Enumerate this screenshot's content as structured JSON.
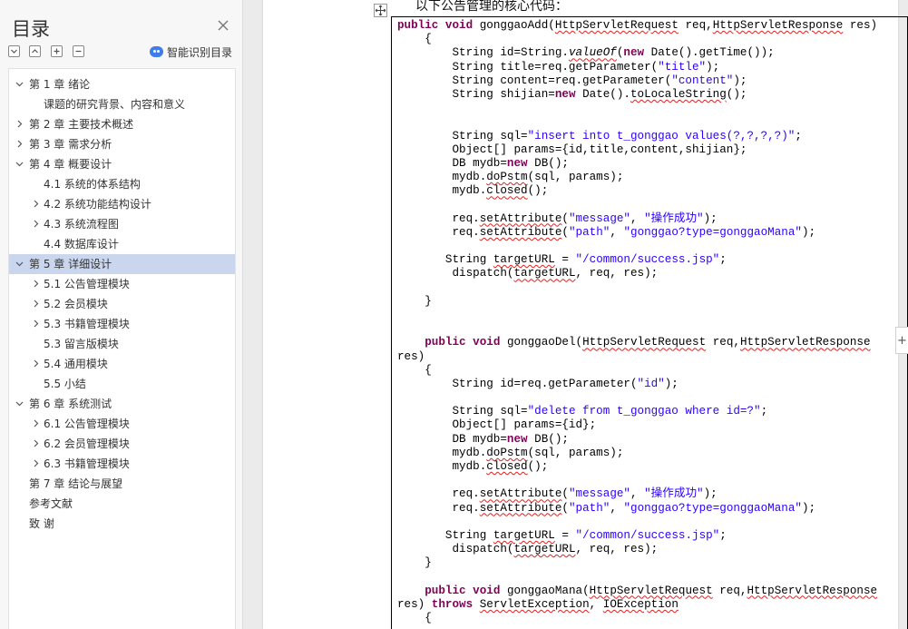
{
  "sidebar": {
    "title": "目录",
    "smart_toc_label": "智能识别目录",
    "tools": [
      "collapse-all",
      "expand-all",
      "add-heading",
      "remove-heading"
    ]
  },
  "toc": [
    {
      "level": 1,
      "label": "第 1 章    绪论",
      "caret": "down"
    },
    {
      "level": 2,
      "label": "课题的研究背景、内容和意义",
      "caret": "none"
    },
    {
      "level": 1,
      "label": "第 2 章    主要技术概述",
      "caret": "right"
    },
    {
      "level": 1,
      "label": "第 3 章    需求分析",
      "caret": "right"
    },
    {
      "level": 1,
      "label": "第 4 章    概要设计",
      "caret": "down"
    },
    {
      "level": 2,
      "label": "4.1    系统的体系结构",
      "caret": "none"
    },
    {
      "level": 2,
      "label": "4.2    系统功能结构设计",
      "caret": "right"
    },
    {
      "level": 2,
      "label": "4.3    系统流程图",
      "caret": "right"
    },
    {
      "level": 2,
      "label": "4.4    数据库设计",
      "caret": "none"
    },
    {
      "level": 1,
      "label": "第 5 章    详细设计",
      "caret": "down",
      "active": true
    },
    {
      "level": 2,
      "label": "5.1    公告管理模块",
      "caret": "right"
    },
    {
      "level": 2,
      "label": "5.2    会员模块",
      "caret": "right"
    },
    {
      "level": 2,
      "label": "5.3    书籍管理模块",
      "caret": "right"
    },
    {
      "level": 2,
      "label": "5.3    留言版模块",
      "caret": "none"
    },
    {
      "level": 2,
      "label": "5.4    通用模块",
      "caret": "right"
    },
    {
      "level": 2,
      "label": "5.5    小结",
      "caret": "none"
    },
    {
      "level": 1,
      "label": "第 6 章    系统测试",
      "caret": "down"
    },
    {
      "level": 2,
      "label": "6.1    公告管理模块",
      "caret": "right"
    },
    {
      "level": 2,
      "label": "6.2    会员管理模块",
      "caret": "right"
    },
    {
      "level": 2,
      "label": "6.3    书籍管理模块",
      "caret": "right"
    },
    {
      "level": 1,
      "label": "第 7 章    结论与展望",
      "caret": "none"
    },
    {
      "level": 1,
      "label": "参考文献",
      "caret": "none"
    },
    {
      "level": 1,
      "label": "致    谢",
      "caret": "none"
    }
  ],
  "document": {
    "intro_text": "以下公告管理的核心代码：",
    "code_lines": [
      "public void gonggaoAdd(HttpServletRequest req,HttpServletResponse res)",
      "    {",
      "        String id=String.valueOf(new Date().getTime());",
      "        String title=req.getParameter(\"title\");",
      "        String content=req.getParameter(\"content\");",
      "        String shijian=new Date().toLocaleString();",
      "",
      "",
      "        String sql=\"insert into t_gonggao values(?,?,?,?)\";",
      "        Object[] params={id,title,content,shijian};",
      "        DB mydb=new DB();",
      "        mydb.doPstm(sql, params);",
      "        mydb.closed();",
      "",
      "        req.setAttribute(\"message\", \"操作成功\");",
      "        req.setAttribute(\"path\", \"gonggao?type=gonggaoMana\");",
      "",
      "       String targetURL = \"/common/success.jsp\";",
      "        dispatch(targetURL, req, res);",
      "",
      "    }",
      "",
      "",
      "    public void gonggaoDel(HttpServletRequest req,HttpServletResponse",
      "res)",
      "    {",
      "        String id=req.getParameter(\"id\");",
      "",
      "        String sql=\"delete from t_gonggao where id=?\";",
      "        Object[] params={id};",
      "        DB mydb=new DB();",
      "        mydb.doPstm(sql, params);",
      "        mydb.closed();",
      "",
      "        req.setAttribute(\"message\", \"操作成功\");",
      "        req.setAttribute(\"path\", \"gonggao?type=gonggaoMana\");",
      "",
      "       String targetURL = \"/common/success.jsp\";",
      "        dispatch(targetURL, req, res);",
      "    }",
      "",
      "    public void gonggaoMana(HttpServletRequest req,HttpServletResponse",
      "res) throws ServletException, IOException",
      "    {"
    ]
  },
  "colors": {
    "keyword": "#7f0055",
    "string": "#2a00ff",
    "squiggle": "#e02020",
    "active_toc": "#c9d6ee"
  }
}
